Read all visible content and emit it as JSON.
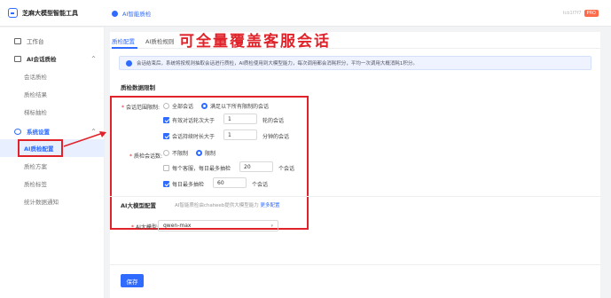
{
  "header": {
    "app_name": "芝麻大模型智能工具",
    "breadcrumb": "AI智能质检",
    "user_name": "tcb1f7f7",
    "user_badge": "PRO"
  },
  "sidebar": {
    "items": [
      {
        "label": "工作台",
        "icon": "monitor-icon"
      },
      {
        "label": "AI会话质检",
        "icon": "check-doc-icon",
        "chevron": "^"
      },
      {
        "label": "会话质检"
      },
      {
        "label": "质检结果"
      },
      {
        "label": "梯标抽检"
      },
      {
        "label": "系统设置",
        "icon": "gear-icon",
        "chevron": "^"
      },
      {
        "label": "AI质检配置"
      },
      {
        "label": "质检方案"
      },
      {
        "label": "质检标签"
      },
      {
        "label": "统计数据通知"
      }
    ]
  },
  "tabs": [
    {
      "label": "质检配置"
    },
    {
      "label": "AI质检规则"
    }
  ],
  "annotation": "可全量覆盖客服会话",
  "notice": "会话结束后，系统将按规则抽取会话进行质检，AI质检使用到大模型能力，每次调用都会消耗积分，平均一次调用大概消耗1积分。",
  "quality_section": {
    "title": "质检数据限制",
    "scope": {
      "label": "会话范围限制:",
      "options": [
        "全部会话",
        "满足以下所有限制的会话"
      ],
      "selected": 1,
      "conditions": [
        {
          "prefix": "有效对话轮次大于",
          "value": "1",
          "suffix": "轮的会话",
          "checked": true
        },
        {
          "prefix": "会话持续时长大于",
          "value": "1",
          "suffix": "分钟的会话",
          "checked": true
        }
      ]
    },
    "sampling": {
      "label": "质检会话数:",
      "options": [
        "不限制",
        "限制"
      ],
      "selected": 1,
      "conditions": [
        {
          "prefix": "每个客服，每日最多抽检",
          "value": "20",
          "suffix": "个会话",
          "checked": false
        },
        {
          "prefix": "每日最多抽检",
          "value": "60",
          "suffix": "个会话",
          "checked": true
        }
      ]
    }
  },
  "ai_section": {
    "title": "AI大模型配置",
    "subtitle": "AI智能质检由chatweb提供大模型能力",
    "link": "更多配置",
    "model_label": "AI大模型:",
    "model_value": "qwen-max"
  },
  "footer": {
    "save_label": "保存"
  },
  "colors": {
    "accent": "#2f6bff",
    "annotation_red": "#e0232a"
  }
}
